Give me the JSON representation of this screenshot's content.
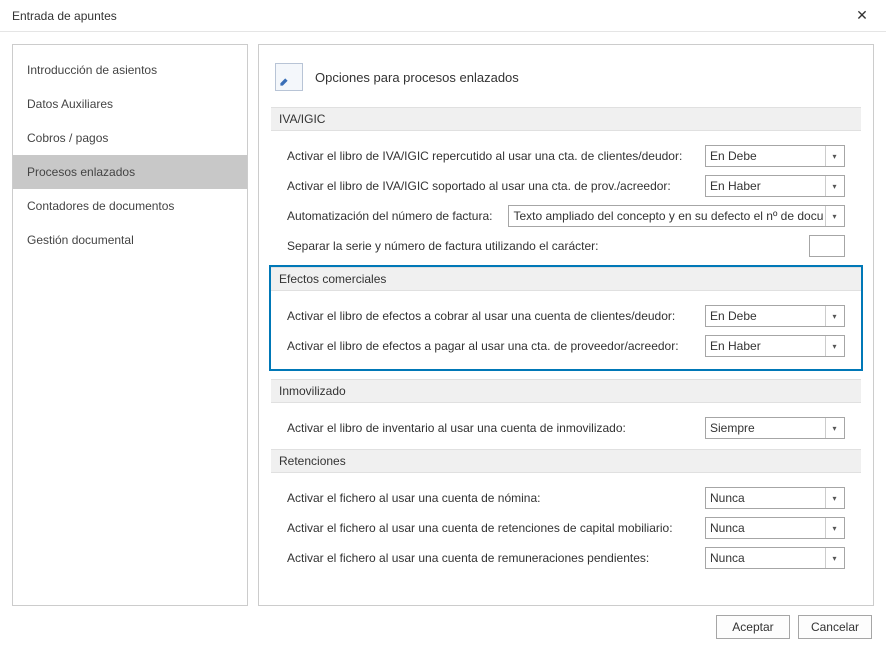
{
  "window": {
    "title": "Entrada de apuntes"
  },
  "sidebar": {
    "items": [
      {
        "label": "Introducción de asientos",
        "selected": false
      },
      {
        "label": "Datos Auxiliares",
        "selected": false
      },
      {
        "label": "Cobros / pagos",
        "selected": false
      },
      {
        "label": "Procesos enlazados",
        "selected": true
      },
      {
        "label": "Contadores de documentos",
        "selected": false
      },
      {
        "label": "Gestión documental",
        "selected": false
      }
    ]
  },
  "page": {
    "title": "Opciones para procesos enlazados"
  },
  "sections": {
    "iva": {
      "header": "IVA/IGIC",
      "row_repercutido_label": "Activar el libro de IVA/IGIC repercutido al usar una cta. de clientes/deudor:",
      "row_repercutido_value": "En Debe",
      "row_soportado_label": "Activar el libro de IVA/IGIC soportado al usar una cta. de prov./acreedor:",
      "row_soportado_value": "En Haber",
      "row_auto_label": "Automatización del número de factura:",
      "row_auto_value": "Texto ampliado del concepto y en su defecto el nº de docu",
      "row_separar_label": "Separar la serie y número de factura utilizando el carácter:",
      "row_separar_value": ""
    },
    "efectos": {
      "header": "Efectos comerciales",
      "row_cobrar_label": "Activar el libro de efectos a cobrar al usar una cuenta de clientes/deudor:",
      "row_cobrar_value": "En Debe",
      "row_pagar_label": "Activar el libro de efectos a pagar al usar una cta. de proveedor/acreedor:",
      "row_pagar_value": "En Haber"
    },
    "inmovilizado": {
      "header": "Inmovilizado",
      "row_inv_label": "Activar el libro de inventario al usar una cuenta de inmovilizado:",
      "row_inv_value": "Siempre"
    },
    "retenciones": {
      "header": "Retenciones",
      "row_nomina_label": "Activar el fichero al usar una cuenta de nómina:",
      "row_nomina_value": "Nunca",
      "row_capital_label": "Activar el fichero al usar una cuenta de retenciones de capital mobiliario:",
      "row_capital_value": "Nunca",
      "row_remu_label": "Activar el fichero al usar una cuenta de remuneraciones pendientes:",
      "row_remu_value": "Nunca"
    }
  },
  "footer": {
    "accept": "Aceptar",
    "cancel": "Cancelar"
  }
}
